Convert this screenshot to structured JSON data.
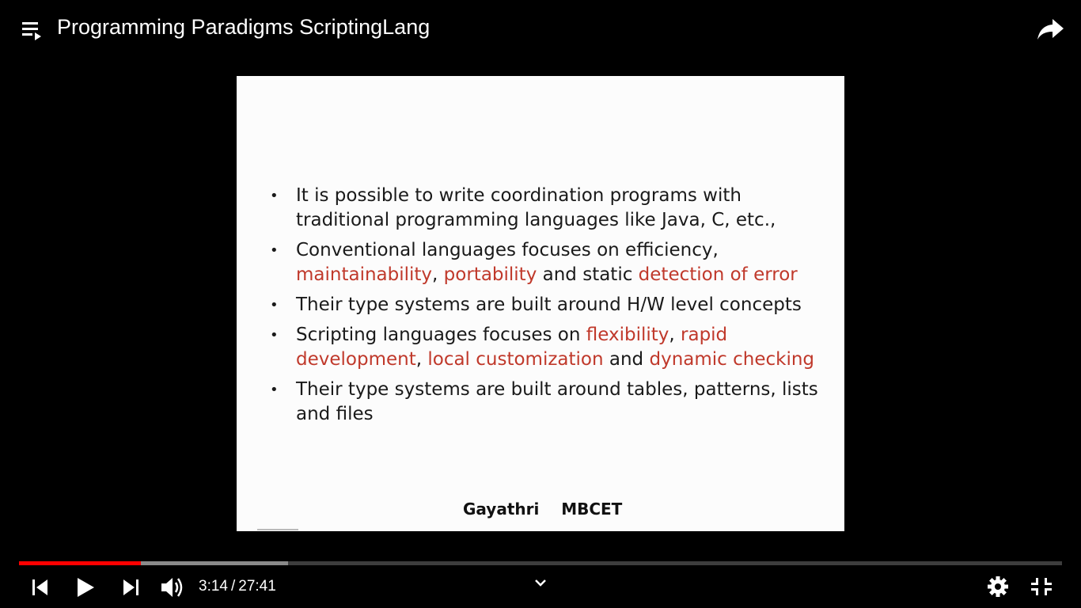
{
  "video": {
    "title": "Programming Paradigms ScriptingLang",
    "current_time": "3:14",
    "separator": "/",
    "duration": "27:41",
    "progress_fraction": 0.117,
    "buffered_fraction": 0.258
  },
  "slide": {
    "bullets": [
      {
        "parts": [
          {
            "text": "It is possible to write coordination programs with traditional programming  languages like Java, C, etc.,",
            "red": false
          }
        ]
      },
      {
        "parts": [
          {
            "text": "Conventional languages focuses on efficiency, ",
            "red": false
          },
          {
            "text": "maintainability",
            "red": true
          },
          {
            "text": ", ",
            "red": false
          },
          {
            "text": "portability",
            "red": true
          },
          {
            "text": " and static ",
            "red": false
          },
          {
            "text": "detection of error",
            "red": true
          }
        ]
      },
      {
        "parts": [
          {
            "text": "Their type systems are built around H/W level concepts",
            "red": false
          }
        ]
      },
      {
        "parts": [
          {
            "text": "Scripting languages focuses on ",
            "red": false
          },
          {
            "text": "flexibility",
            "red": true
          },
          {
            "text": ", ",
            "red": false
          },
          {
            "text": "rapid development",
            "red": true
          },
          {
            "text": ", ",
            "red": false
          },
          {
            "text": "local customization",
            "red": true
          },
          {
            "text": " and ",
            "red": false
          },
          {
            "text": "dynamic checking",
            "red": true
          }
        ]
      },
      {
        "parts": [
          {
            "text": "Their type systems are built  around tables, patterns, lists and files",
            "red": false
          }
        ]
      }
    ],
    "bullet_glyph": "•",
    "footer": "Gayathri    MBCET"
  },
  "icons": {
    "playlist": "playlist-icon",
    "share": "share-icon",
    "previous": "previous-icon",
    "play": "play-icon",
    "next": "next-icon",
    "volume": "volume-icon",
    "chevron": "chevron-down-icon",
    "settings": "gear-icon",
    "exit_fullscreen": "exit-fullscreen-icon"
  },
  "colors": {
    "progress_played": "#ff0000",
    "highlight_text": "#c0392b"
  }
}
